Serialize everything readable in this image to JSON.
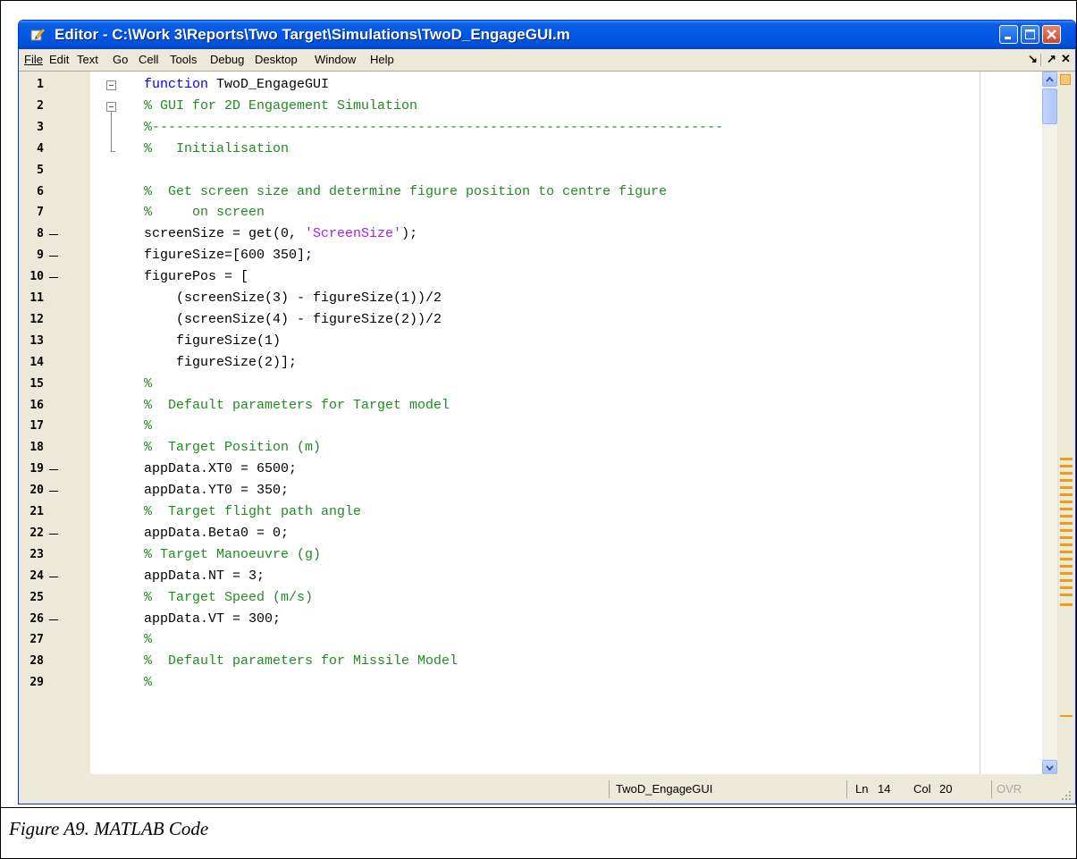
{
  "window": {
    "title": "Editor - C:\\Work 3\\Reports\\Two Target\\Simulations\\TwoD_EngageGUI.m"
  },
  "menu": [
    "File",
    "Edit",
    "Text",
    "Go",
    "Cell",
    "Tools",
    "Debug",
    "Desktop",
    "Window",
    "Help"
  ],
  "dock_controls": {
    "undock": "↘",
    "dock": "↗",
    "close": "✕"
  },
  "editor": {
    "lines": [
      {
        "n": "1",
        "text": "function TwoD_EngageGUI",
        "kind": "function"
      },
      {
        "n": "2",
        "text": "% GUI for 2D Engagement Simulation",
        "kind": "comment"
      },
      {
        "n": "3",
        "text": "%-----------------------------------------------------------------------",
        "kind": "comment"
      },
      {
        "n": "4",
        "text": "%   Initialisation",
        "kind": "comment"
      },
      {
        "n": "5",
        "text": "",
        "kind": "plain"
      },
      {
        "n": "6",
        "text": "%  Get screen size and determine figure position to centre figure",
        "kind": "comment"
      },
      {
        "n": "7",
        "text": "%     on screen",
        "kind": "comment"
      },
      {
        "n": "8",
        "text": "screenSize = get(0, ",
        "str": "'ScreenSize'",
        "after": ");",
        "kind": "string",
        "dash": true
      },
      {
        "n": "9",
        "text": "figureSize=[600 350];",
        "kind": "plain",
        "dash": true
      },
      {
        "n": "10",
        "text": "figurePos = [",
        "kind": "plain",
        "dash": true
      },
      {
        "n": "11",
        "text": "    (screenSize(3) - figureSize(1))/2",
        "kind": "plain"
      },
      {
        "n": "12",
        "text": "    (screenSize(4) - figureSize(2))/2",
        "kind": "plain"
      },
      {
        "n": "13",
        "text": "    figureSize(1)",
        "kind": "plain"
      },
      {
        "n": "14",
        "text": "    figureSize(2)];",
        "kind": "plain"
      },
      {
        "n": "15",
        "text": "%",
        "kind": "comment"
      },
      {
        "n": "16",
        "text": "%  Default parameters for Target model",
        "kind": "comment"
      },
      {
        "n": "17",
        "text": "%",
        "kind": "comment"
      },
      {
        "n": "18",
        "text": "%  Target Position (m)",
        "kind": "comment"
      },
      {
        "n": "19",
        "text": "appData.XT0 = 6500;",
        "kind": "plain",
        "dash": true
      },
      {
        "n": "20",
        "text": "appData.YT0 = 350;",
        "kind": "plain",
        "dash": true
      },
      {
        "n": "21",
        "text": "%  Target flight path angle",
        "kind": "comment"
      },
      {
        "n": "22",
        "text": "appData.Beta0 = 0;",
        "kind": "plain",
        "dash": true
      },
      {
        "n": "23",
        "text": "% Target Manoeuvre (g)",
        "kind": "comment"
      },
      {
        "n": "24",
        "text": "appData.NT = 3;",
        "kind": "plain",
        "dash": true
      },
      {
        "n": "25",
        "text": "%  Target Speed (m/s)",
        "kind": "comment"
      },
      {
        "n": "26",
        "text": "appData.VT = 300;",
        "kind": "plain",
        "dash": true
      },
      {
        "n": "27",
        "text": "%",
        "kind": "comment"
      },
      {
        "n": "28",
        "text": "%  Default parameters for Missile Model",
        "kind": "comment"
      },
      {
        "n": "29",
        "text": "%",
        "kind": "comment"
      }
    ]
  },
  "status": {
    "function_name": "TwoD_EngageGUI",
    "ln_label": "Ln",
    "ln_value": "14",
    "col_label": "Col",
    "col_value": "20",
    "ovr": "OVR"
  },
  "caption": "Figure A9. MATLAB Code",
  "colors": {
    "keyword": "#0000ff",
    "comment": "#228b22",
    "string": "#a020f0",
    "titlebar": "#0058e6",
    "warning_marker": "#f09a1a"
  }
}
